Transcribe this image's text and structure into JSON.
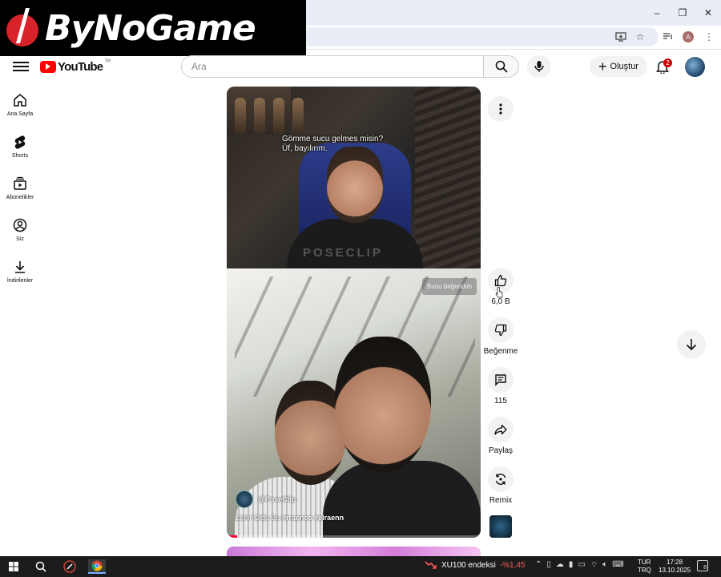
{
  "brand_overlay": {
    "text": "ByNoGame"
  },
  "browser": {
    "profile_initial": "A",
    "window_buttons": [
      "–",
      "❐",
      "✕"
    ]
  },
  "header": {
    "logo_text": "YouTube",
    "region": "TR",
    "search_placeholder": "Ara",
    "create_label": "Oluştur",
    "notification_count": "2"
  },
  "sidebar": {
    "items": [
      {
        "label": "Ana Sayfa",
        "icon": "home-icon"
      },
      {
        "label": "Shorts",
        "icon": "shorts-icon"
      },
      {
        "label": "Abonelikler",
        "icon": "subscriptions-icon"
      },
      {
        "label": "Siz",
        "icon": "you-icon"
      },
      {
        "label": "İndirilenler",
        "icon": "download-icon"
      }
    ]
  },
  "short": {
    "caption_line1": "Gömme sucu gelmes misin?",
    "caption_line2": "Üf, bayılırım.",
    "watermark": "POSECLIP",
    "liked_tooltip": "Bunu beğendim",
    "channel": "@PoseClip",
    "title_plain": "Zehir Oldu Bu",
    "title_tags": "#rraenee #elraenn",
    "progress_fraction": 0.04
  },
  "actions": {
    "like_count": "6,0 B",
    "dislike_label": "Beğenme",
    "comments_count": "115",
    "share_label": "Paylaş",
    "remix_label": "Remix"
  },
  "taskbar": {
    "stock_name": "XU100 endeksi",
    "stock_change": "-%1,45",
    "lang_line1": "TUR",
    "lang_line2": "TRQ",
    "time": "17:28",
    "date": "13.10.2025",
    "notification_count": "8"
  }
}
